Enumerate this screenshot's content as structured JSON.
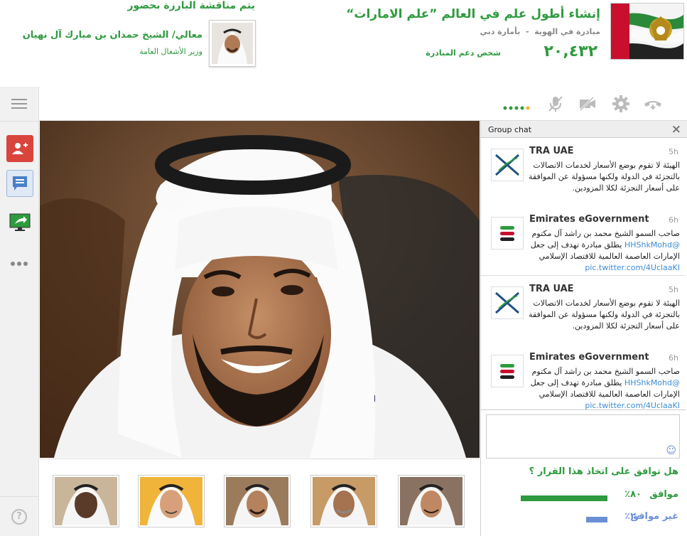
{
  "header": {
    "title": "إنشاء أطول علم في العالم ”علم الامارات“",
    "subtitle_part1": "مبادرة في الهوية",
    "subtitle_sep": "-",
    "subtitle_part2": "بأمارة دبي",
    "supporters_count": "٢٠,٤٣٢",
    "supporters_label": "شخص دعم المبادرة",
    "presence_text": "يتم مناقشة البارزة بحضور",
    "guest_name": "معالي/ الشيخ حمدان بن مبارك آل نهيان",
    "guest_role": "وزير الأشغال العامة"
  },
  "toolbar": {
    "icons": [
      "hangup-icon",
      "settings-icon",
      "camera-off-icon",
      "mic-off-icon",
      "signal-icon"
    ]
  },
  "rail": {
    "icons": [
      "menu-icon",
      "add-person-icon",
      "chat-icon",
      "screenshare-icon",
      "more-icon",
      "help-icon"
    ]
  },
  "chat": {
    "header": "Group chat",
    "close": "×",
    "messages": [
      {
        "name": "TRA UAE",
        "time": "5h",
        "text": "الهيئة لا تقوم بوضع الأسعار لخدمات الاتصالات بالتجزئة في الدولة ولكنها مسؤولة عن الموافقة على أسعار التجزئة لكلا المزودين."
      },
      {
        "name": "Emirates eGovernment",
        "time": "6h",
        "text_before": "صاحب السمو الشيخ محمد بن راشد آل مكتوم ",
        "mention": "@HHShkMohd",
        "text_after": " يطلق مبادرة تهدف إلى جعل الإمارات العاصمة العالمية للاقتصاد الإسلامي ",
        "link": "pic.twitter.com/4UclaaKI"
      },
      {
        "name": "TRA UAE",
        "time": "5h",
        "text": "الهيئة لا تقوم بوضع الأسعار لخدمات الاتصالات بالتجزئة في الدولة ولكنها مسؤولة عن الموافقة على أسعار التجزئة لكلا المزودين."
      },
      {
        "name": "Emirates eGovernment",
        "time": "6h",
        "text_before": "صاحب السمو الشيخ محمد بن راشد آل مكتوم ",
        "mention": "@HHShkMohd",
        "text_after": " يطلق مبادرة تهدف إلى جعل الإمارات العاصمة العالمية للاقتصاد الإسلامي ",
        "link": "pic.twitter.com/4UclaaKI"
      }
    ],
    "input_placeholder": "",
    "emoji": "☺"
  },
  "poll": {
    "question": "هل توافق على اتخاذ هذا القرار ؟",
    "options": [
      {
        "label": "موافق",
        "percent_text": "٨٠٪",
        "value": 0.8,
        "color": "#2e9b3e"
      },
      {
        "label": "غير موافق",
        "percent_text": "٢٠٪",
        "value": 0.2,
        "color": "#6b8fd6"
      }
    ]
  },
  "colors": {
    "accent_green": "#2e9b3e",
    "add_person_red": "#d9453d",
    "link_blue": "#3b8dd3"
  }
}
